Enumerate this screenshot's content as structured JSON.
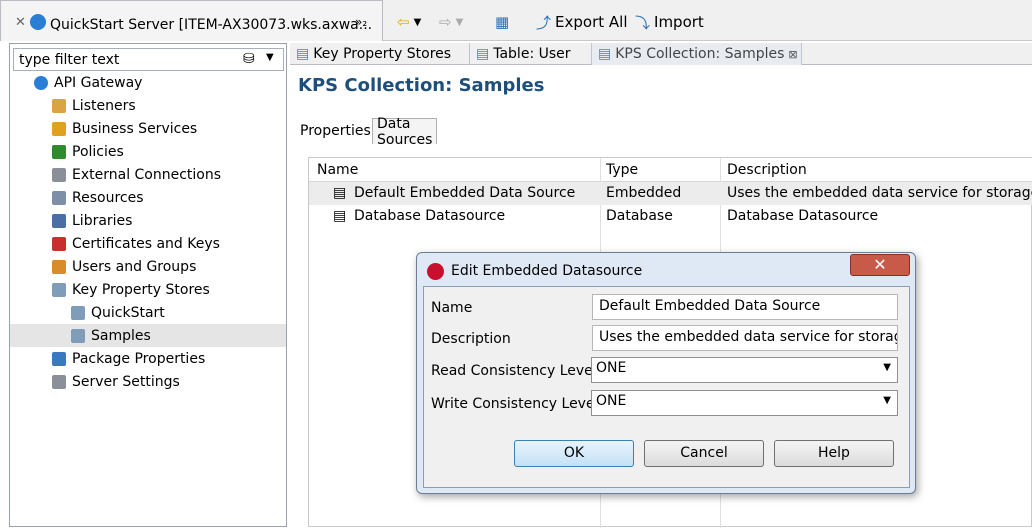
{
  "left_tab": {
    "title": "QuickStart Server [ITEM-AX30073.wks.axwa...",
    "more": "»₂"
  },
  "toolbar": {
    "export_all": "Export All",
    "import": "Import"
  },
  "filter": {
    "placeholder": "type filter text"
  },
  "tree": {
    "root": "API Gateway",
    "items": [
      "Listeners",
      "Business Services",
      "Policies",
      "External Connections",
      "Resources",
      "Libraries",
      "Certificates and Keys",
      "Users and Groups",
      "Key Property Stores"
    ],
    "kps_children": [
      "QuickStart",
      "Samples"
    ],
    "after": [
      "Package Properties",
      "Server Settings"
    ]
  },
  "editor_tabs": [
    "Key Property Stores",
    "Table: User",
    "KPS Collection: Samples"
  ],
  "page_title": "KPS Collection: Samples",
  "sub_tabs": [
    "Properties",
    "Data Sources"
  ],
  "table": {
    "headers": [
      "Name",
      "Type",
      "Description"
    ],
    "rows": [
      [
        "Default Embedded Data Source",
        "Embedded",
        "Uses the embedded data service for storage"
      ],
      [
        "Database Datasource",
        "Database",
        "Database Datasource"
      ]
    ]
  },
  "dialog": {
    "title": "Edit Embedded Datasource",
    "name_label": "Name",
    "name_value": "Default Embedded Data Source",
    "desc_label": "Description",
    "desc_value": "Uses the embedded data service for storage",
    "read_label": "Read Consistency Level",
    "read_value": "ONE",
    "write_label": "Write Consistency Level",
    "write_value": "ONE",
    "ok": "OK",
    "cancel": "Cancel",
    "help": "Help"
  }
}
